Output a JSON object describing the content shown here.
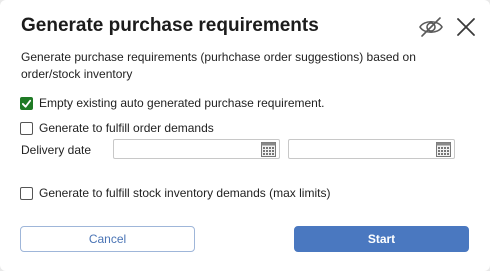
{
  "dialog": {
    "title": "Generate purchase requirements",
    "description": "Generate purchase requirements (purhchase order suggestions) based on order/stock inventory",
    "icons": {
      "visibility_toggle": "eye-slash-icon",
      "close": "close-icon"
    }
  },
  "options": [
    {
      "label": "Empty existing auto generated purchase requirement.",
      "checked": true
    },
    {
      "label": "Generate to fulfill order demands",
      "checked": false
    },
    {
      "label": "Generate to fulfill stock inventory demands (max limits)",
      "checked": false
    }
  ],
  "delivery_date": {
    "label": "Delivery date",
    "from_value": "",
    "to_value": "",
    "icon": "calendar-icon"
  },
  "buttons": {
    "cancel": "Cancel",
    "start": "Start"
  },
  "colors": {
    "accent": "#4a78c0",
    "check": "#1f7a25",
    "cancel_text": "#4a74b5"
  }
}
